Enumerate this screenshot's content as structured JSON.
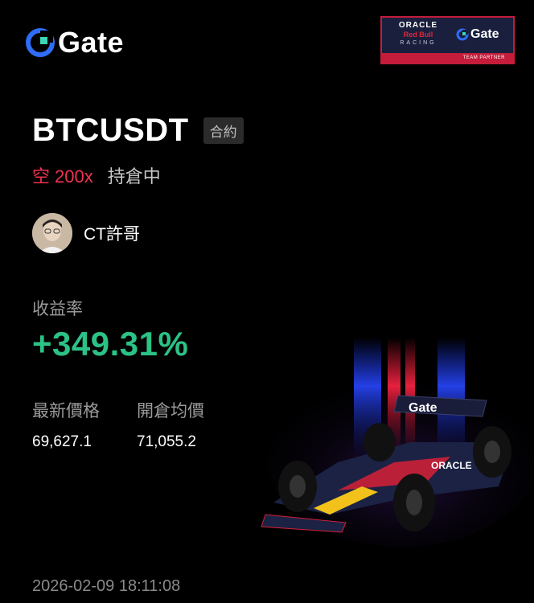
{
  "brand": {
    "name": "Gate",
    "logo_icon": "gate-logo-icon"
  },
  "partner_badge": {
    "oracle": "ORACLE",
    "redbull": "Red Bull",
    "racing": "RACING",
    "gate": "Gate",
    "team_partner": "TEAM PARTNER"
  },
  "position": {
    "pair": "BTCUSDT",
    "type_badge": "合約",
    "side": "空",
    "leverage": "200x",
    "status": "持倉中"
  },
  "user": {
    "name": "CT許哥",
    "avatar": "avatar-photo"
  },
  "roi": {
    "label": "收益率",
    "value": "+349.31%"
  },
  "prices": {
    "latest_label": "最新價格",
    "latest_value": "69,627.1",
    "entry_label": "開倉均價",
    "entry_value": "71,055.2"
  },
  "timestamp": "2026-02-09 18:11:08",
  "colors": {
    "background": "#000000",
    "short_red": "#f0324f",
    "profit_green": "#2cc286",
    "muted_text": "#9a9a9a",
    "partner_red": "#c41c3a",
    "partner_navy": "#1a1f3d"
  }
}
